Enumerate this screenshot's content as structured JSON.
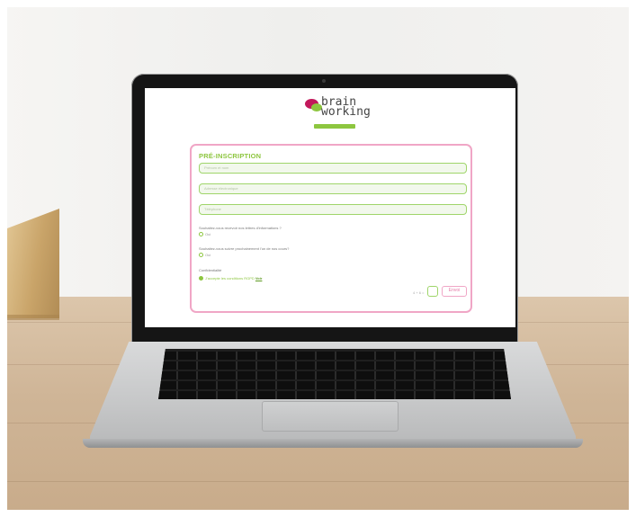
{
  "logo": {
    "line1": "brain",
    "line2": "working"
  },
  "form": {
    "title": "PRÉ-INSCRIPTION",
    "fields": [
      {
        "placeholder": "Prénom et nom"
      },
      {
        "placeholder": "Adresse électronique"
      },
      {
        "placeholder": "Téléphone"
      }
    ],
    "questions": [
      {
        "text": "Souhaitez-vous recevoir nos lettres d'informations ?",
        "option": "Oui"
      },
      {
        "text": "Souhaitez-vous suivre prochainement l'un de nos cours?",
        "option": "Oui"
      }
    ],
    "consent_title": "Confidentialité",
    "consent_text": "J'accepte les conditions RGPD",
    "consent_link": "Voir",
    "captcha_label": "4 + 6 =",
    "send_label": "Envoi"
  },
  "colors": {
    "brand_green": "#8dc63f",
    "brand_pink": "#c2185b",
    "border_pink": "#f0a6c6"
  }
}
